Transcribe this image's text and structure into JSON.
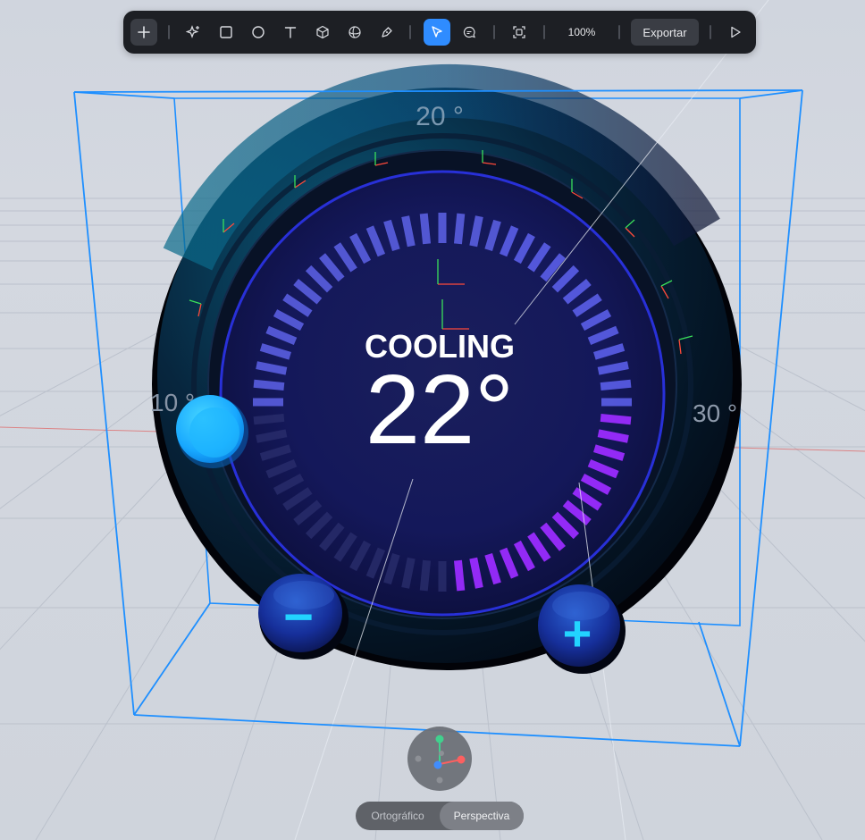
{
  "toolbar": {
    "add_icon": "plus-icon",
    "tools": [
      "ai-sparkle-icon",
      "rectangle-icon",
      "ellipse-icon",
      "text-icon",
      "cube-icon",
      "sphere-icon",
      "pen-icon",
      "pointer-icon",
      "comment-icon",
      "frame-icon"
    ],
    "zoom": "100%",
    "export_label": "Exportar",
    "play_icon": "play-icon",
    "accent": "#2f8cff"
  },
  "thermostat": {
    "mode": "COOLING",
    "temperature": "22°",
    "scale_min_label": "10 °",
    "scale_mid_label": "20 °",
    "scale_max_label": "30 °",
    "minus_label": "−",
    "plus_label": "+",
    "ring_color": "#1a1fb8",
    "active_color": "#a026ff",
    "knob_color": "#19b6ff"
  },
  "viewport": {
    "projection_options": [
      "Ortográfico",
      "Perspectiva"
    ],
    "active_projection": "Perspectiva"
  }
}
